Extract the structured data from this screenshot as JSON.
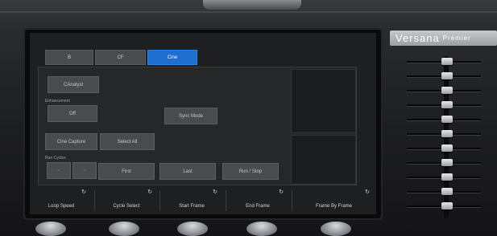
{
  "brand": {
    "name": "Versana",
    "model": "Premier"
  },
  "tabs": [
    {
      "label": "B",
      "active": false
    },
    {
      "label": "CF",
      "active": false
    },
    {
      "label": "Cine",
      "active": true
    }
  ],
  "cine_panel": {
    "canalyst_label": "CAnalyst",
    "enhancement_label": "Enhancement",
    "enhancement_value": "Off",
    "sync_mode_label": "Sync Mode",
    "cine_capture_label": "Cine Capture",
    "select_all_label": "Select All",
    "run_cycles_label": "Run Cycles",
    "run_cycles_prev": "<",
    "run_cycles_next": ">",
    "first_label": "First",
    "last_label": "Last",
    "run_stop_label": "Run / Stop"
  },
  "softkeys": [
    {
      "label": "Loop Speed"
    },
    {
      "label": "Cycle Select"
    },
    {
      "label": "Start Frame"
    },
    {
      "label": "End Frame"
    },
    {
      "label": "Frame By Frame"
    }
  ],
  "softkey_icon": "↻",
  "accent_color": "#1f6fd0"
}
